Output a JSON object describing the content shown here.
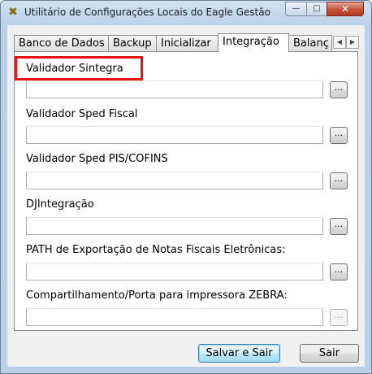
{
  "window": {
    "title": "Utilitário de Configurações Locais do Eagle Gestão",
    "controls": {
      "minimize": "—",
      "maximize": "□",
      "close": "✕"
    }
  },
  "tabs": [
    {
      "label": "Banco de Dados",
      "active": false
    },
    {
      "label": "Backup",
      "active": false
    },
    {
      "label": "Inicializar",
      "active": false
    },
    {
      "label": "Integração",
      "active": true
    },
    {
      "label": "Balanç",
      "active": false
    }
  ],
  "tab_scroll": {
    "left": "◀",
    "right": "▶"
  },
  "fields": [
    {
      "label": "Validador Sintegra",
      "value": "",
      "browse": "...",
      "highlighted": true,
      "enabled": true
    },
    {
      "label": "Validador Sped Fiscal",
      "value": "",
      "browse": "...",
      "enabled": true
    },
    {
      "label": "Validador Sped PIS/COFINS",
      "value": "",
      "browse": "...",
      "enabled": true
    },
    {
      "label": "DJIntegração",
      "value": "",
      "browse": "...",
      "enabled": true
    },
    {
      "label": "PATH de Exportação de Notas Fiscais Eletrônicas:",
      "value": "",
      "browse": "...",
      "enabled": true
    },
    {
      "label": "Compartilhamento/Porta para impressora ZEBRA:",
      "value": "",
      "browse": "...",
      "enabled": false
    }
  ],
  "buttons": {
    "save_exit": "Salvar e Sair",
    "exit": "Sair"
  },
  "colors": {
    "highlight": "#ee1111",
    "default_button_border": "#3c7fb1"
  }
}
